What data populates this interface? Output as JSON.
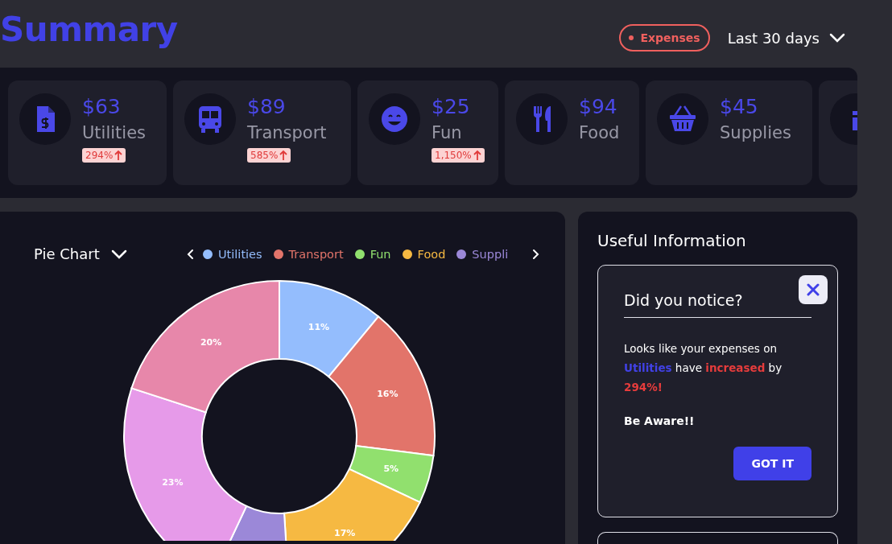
{
  "header": {
    "title": "Summary",
    "filter_tag": {
      "label": "Expenses"
    },
    "range": {
      "label": "Last 30 days"
    }
  },
  "stats": [
    {
      "amount": "$63",
      "label": "Utilities",
      "change": "294%"
    },
    {
      "amount": "$89",
      "label": "Transport",
      "change": "585%"
    },
    {
      "amount": "$25",
      "label": "Fun",
      "change": "1,150%"
    },
    {
      "amount": "$94",
      "label": "Food"
    },
    {
      "amount": "$45",
      "label": "Supplies"
    },
    {
      "kind": "partial"
    }
  ],
  "chart_panel": {
    "dropdown": {
      "label": "Pie Chart"
    },
    "legend": [
      {
        "label": "Utilities",
        "color": "#94bdfd"
      },
      {
        "label": "Transport",
        "color": "#e2746a"
      },
      {
        "label": "Fun",
        "color": "#91e06e"
      },
      {
        "label": "Food",
        "color": "#f6b942"
      },
      {
        "label": "Suppli",
        "color": "#9b88d8"
      }
    ],
    "chart_data": {
      "type": "donut",
      "values": [
        11,
        16,
        5,
        17,
        8,
        23,
        20
      ],
      "colors": [
        "#94bdfd",
        "#e2746a",
        "#91e06e",
        "#f6b942",
        "#9b88d8",
        "#e69ae9",
        "#e787aa"
      ],
      "value_labels": [
        "11%",
        "16%",
        "5%",
        "17%",
        null,
        "23%",
        "20%"
      ]
    }
  },
  "info_panel": {
    "title": "Useful Information",
    "notice": {
      "title": "Did you notice?",
      "message": "Looks like your expenses on **Utilities** have **increased** by **294%!**",
      "emphasis": "Be Aware!!",
      "button": "GOT IT"
    }
  }
}
